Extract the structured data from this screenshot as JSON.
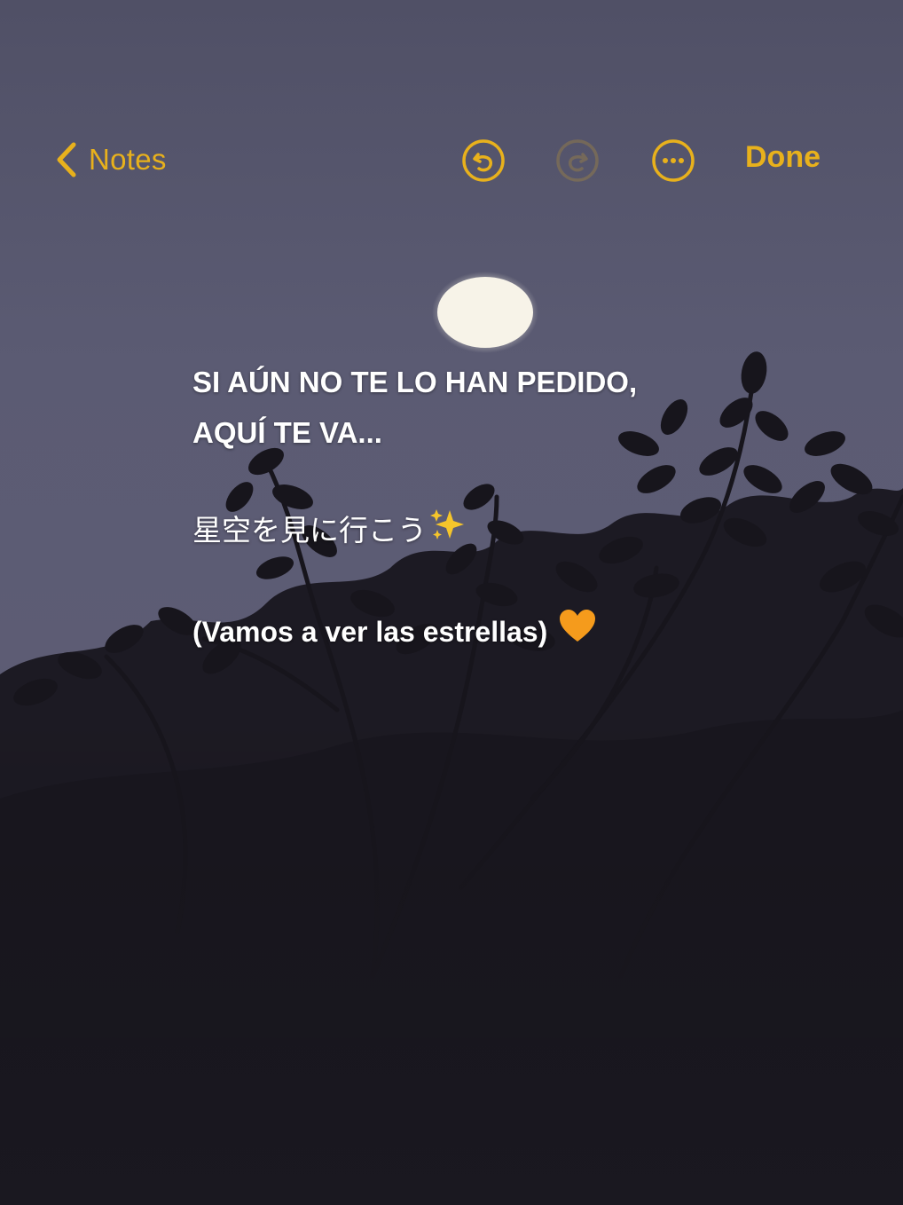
{
  "navbar": {
    "back_label": "Notes",
    "done_label": "Done",
    "accent_color": "#e8b11c",
    "icons": [
      "chevron-left-icon",
      "undo-icon",
      "redo-icon",
      "more-icon"
    ]
  },
  "note": {
    "line1": "SI AÚN NO TE LO HAN PEDIDO,",
    "line2": "AQUÍ TE VA...",
    "japanese": "星空を見に行こう",
    "translation": "(Vamos a ver las estrellas)",
    "emoji_after_japanese": "sparkles-icon",
    "emoji_after_translation": "orange-heart-icon"
  }
}
